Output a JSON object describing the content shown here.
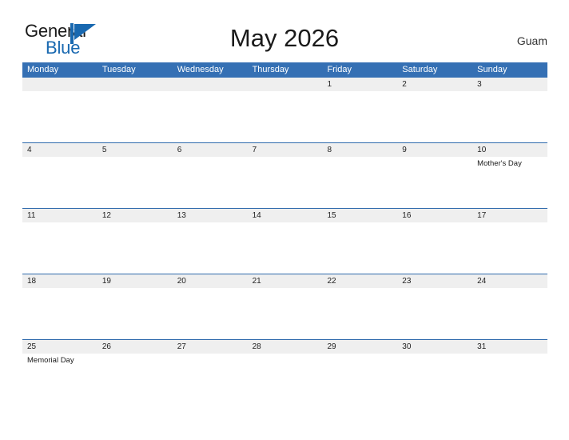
{
  "brand": {
    "line1": "General",
    "line2": "Blue",
    "mark_icon": "triangle-flag-icon",
    "accent_color": "#1868b0"
  },
  "header": {
    "title": "May 2026",
    "region": "Guam"
  },
  "colors": {
    "header_blue": "#3570b4",
    "row_border_blue": "#2f6aac",
    "date_band_gray": "#efefef",
    "page_background": "#ffffff",
    "text_dark": "#1a1a1a"
  },
  "calendar": {
    "weekdays": [
      "Monday",
      "Tuesday",
      "Wednesday",
      "Thursday",
      "Friday",
      "Saturday",
      "Sunday"
    ],
    "weeks": [
      {
        "days": [
          {
            "date": "",
            "events": []
          },
          {
            "date": "",
            "events": []
          },
          {
            "date": "",
            "events": []
          },
          {
            "date": "",
            "events": []
          },
          {
            "date": "1",
            "events": []
          },
          {
            "date": "2",
            "events": []
          },
          {
            "date": "3",
            "events": []
          }
        ]
      },
      {
        "days": [
          {
            "date": "4",
            "events": []
          },
          {
            "date": "5",
            "events": []
          },
          {
            "date": "6",
            "events": []
          },
          {
            "date": "7",
            "events": []
          },
          {
            "date": "8",
            "events": []
          },
          {
            "date": "9",
            "events": []
          },
          {
            "date": "10",
            "events": [
              "Mother's Day"
            ]
          }
        ]
      },
      {
        "days": [
          {
            "date": "11",
            "events": []
          },
          {
            "date": "12",
            "events": []
          },
          {
            "date": "13",
            "events": []
          },
          {
            "date": "14",
            "events": []
          },
          {
            "date": "15",
            "events": []
          },
          {
            "date": "16",
            "events": []
          },
          {
            "date": "17",
            "events": []
          }
        ]
      },
      {
        "days": [
          {
            "date": "18",
            "events": []
          },
          {
            "date": "19",
            "events": []
          },
          {
            "date": "20",
            "events": []
          },
          {
            "date": "21",
            "events": []
          },
          {
            "date": "22",
            "events": []
          },
          {
            "date": "23",
            "events": []
          },
          {
            "date": "24",
            "events": []
          }
        ]
      },
      {
        "days": [
          {
            "date": "25",
            "events": [
              "Memorial Day"
            ]
          },
          {
            "date": "26",
            "events": []
          },
          {
            "date": "27",
            "events": []
          },
          {
            "date": "28",
            "events": []
          },
          {
            "date": "29",
            "events": []
          },
          {
            "date": "30",
            "events": []
          },
          {
            "date": "31",
            "events": []
          }
        ]
      }
    ]
  }
}
